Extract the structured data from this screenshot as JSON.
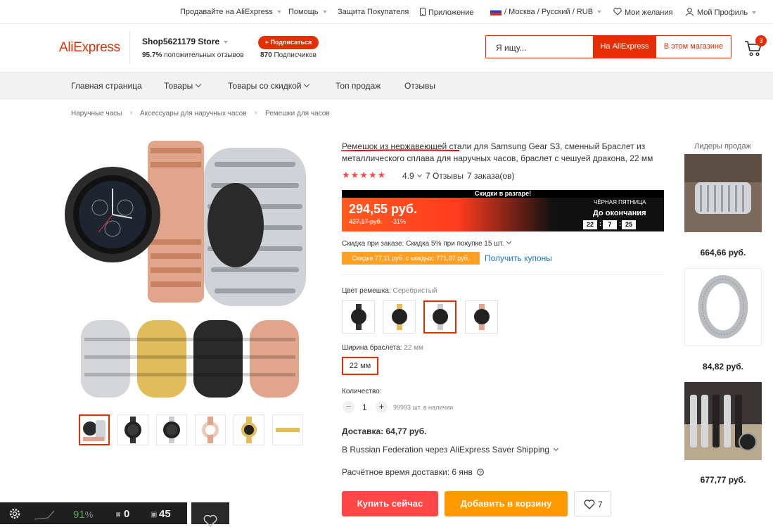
{
  "topbar": {
    "sell": "Продавайте на AliExpress",
    "help": "Помощь",
    "protection": "Защита Покупателя",
    "app": "Приложение",
    "region": "/ Москва / Русский / RUB",
    "wishlist": "Мои желания",
    "profile": "Мой Профиль"
  },
  "header": {
    "logo": "AliExpress",
    "store_name": "Shop5621179 Store",
    "positive_pct": "95.7%",
    "positive_text": " положительных отзывов",
    "subscribe_label": "+ Подписаться",
    "subscribers_count": "870",
    "subscribers_text": " Подписчиков",
    "search_placeholder": "Я ищу...",
    "search_btn_ali": "На AliExpress",
    "search_btn_store": "В этом магазине",
    "cart_count": "3"
  },
  "nav": {
    "home": "Главная страница",
    "products": "Товары",
    "discounts": "Товары со скидкой",
    "top": "Топ продаж",
    "reviews": "Отзывы"
  },
  "breadcrumbs": [
    "Наручные часы",
    "Аксессуары для наручных часов",
    "Ремешки для часов"
  ],
  "product": {
    "title": "Ремешок из нержавеющей стали для Samsung Gear S3, сменный Браслет из металлического сплава для наручных часов, браслет с чешуей дракона, 22 мм",
    "stars": "★★★★★",
    "rating": "4.9",
    "reviews": "7 Отзывы",
    "orders": "7 заказа(ов)",
    "banner_top": "Скидки в разгаре!",
    "price": "294,55 руб.",
    "old_price": "427,17 руб.",
    "discount": "-31%",
    "black_friday": "ЧЁРНАЯ ПЯТНИЦА",
    "until_end": "До окончания",
    "timer": [
      "22",
      "7",
      "25"
    ],
    "order_discount": "Скидка при заказе: Скидка 5% при покупке 15 шт.",
    "coupon": "Скидка 77,11 руб. с каждых: 771,07 руб.",
    "get_coupons": "Получить купоны",
    "color_label": "Цвет ремешка:",
    "color_value": "Серебристый",
    "width_label": "Ширина браслета:",
    "width_value": "22 мм",
    "size_option": "22 мм",
    "qty_label": "Количество:",
    "qty": "1",
    "stock": "99993 шт. в наличии",
    "delivery": "Доставка: 64,77 руб.",
    "ship_via": "В Russian Federation через AliExpress Saver Shipping",
    "eta": "Расчётное время доставки: 6 янв",
    "buy_now": "Купить сейчас",
    "add_to_cart": "Добавить в корзину",
    "wish_count": "7"
  },
  "sidebar": {
    "title": "Лидеры продаж",
    "items": [
      {
        "price": "664,66 руб."
      },
      {
        "price": "84,82 руб."
      },
      {
        "price": "677,77 руб."
      }
    ]
  },
  "overlay": {
    "battery": "91",
    "battery_unit": "%",
    "count1": "0",
    "count2": "45"
  },
  "colors": {
    "accent": "#e62e04",
    "buy": "#ff4747",
    "cart": "#ff9900",
    "link": "#1976d2"
  }
}
